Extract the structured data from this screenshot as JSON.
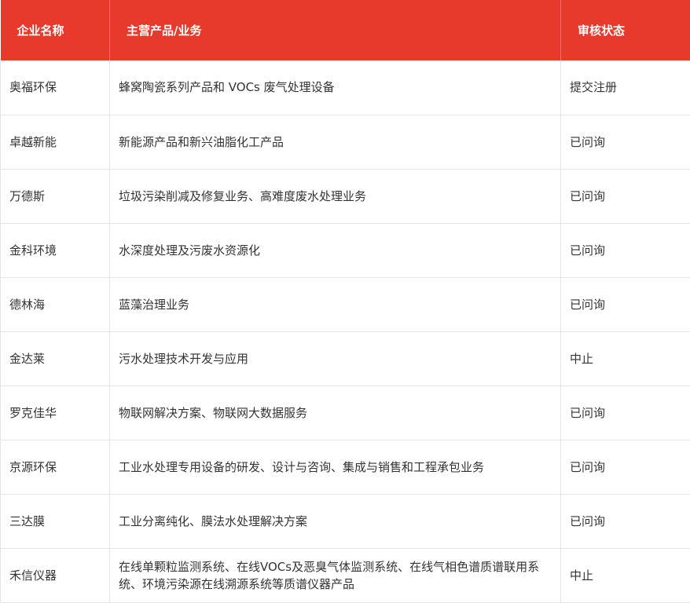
{
  "header": {
    "company": "企业名称",
    "business": "主营产品/业务",
    "status": "审核状态"
  },
  "rows": [
    {
      "company": "奥福环保",
      "business": "蜂窝陶瓷系列产品和 VOCs 废气处理设备",
      "status": "提交注册"
    },
    {
      "company": "卓越新能",
      "business": "新能源产品和新兴油脂化工产品",
      "status": "已问询"
    },
    {
      "company": "万德斯",
      "business": "垃圾污染削减及修复业务、高难度废水处理业务",
      "status": "已问询"
    },
    {
      "company": "金科环境",
      "business": "水深度处理及污废水资源化",
      "status": "已问询"
    },
    {
      "company": "德林海",
      "business": "蓝藻治理业务",
      "status": "已问询"
    },
    {
      "company": "金达莱",
      "business": "污水处理技术开发与应用",
      "status": "中止"
    },
    {
      "company": "罗克佳华",
      "business": "物联网解决方案、物联网大数据服务",
      "status": "已问询"
    },
    {
      "company": "京源环保",
      "business": "工业水处理专用设备的研发、设计与咨询、集成与销售和工程承包业务",
      "status": "已问询"
    },
    {
      "company": "三达膜",
      "business": "工业分离纯化、膜法水处理解决方案",
      "status": "已问询"
    },
    {
      "company": "禾信仪器",
      "business": "在线单颗粒监测系统、在线VOCs及恶臭气体监测系统、在线气相色谱质谱联用系统、环境污染源在线溯源系统等质谱仪器产品",
      "status": "中止"
    }
  ],
  "colors": {
    "header_bg": "#e8392d",
    "header_text": "#ffffff",
    "body_text": "#333333",
    "grid": "#e6e6e6"
  }
}
